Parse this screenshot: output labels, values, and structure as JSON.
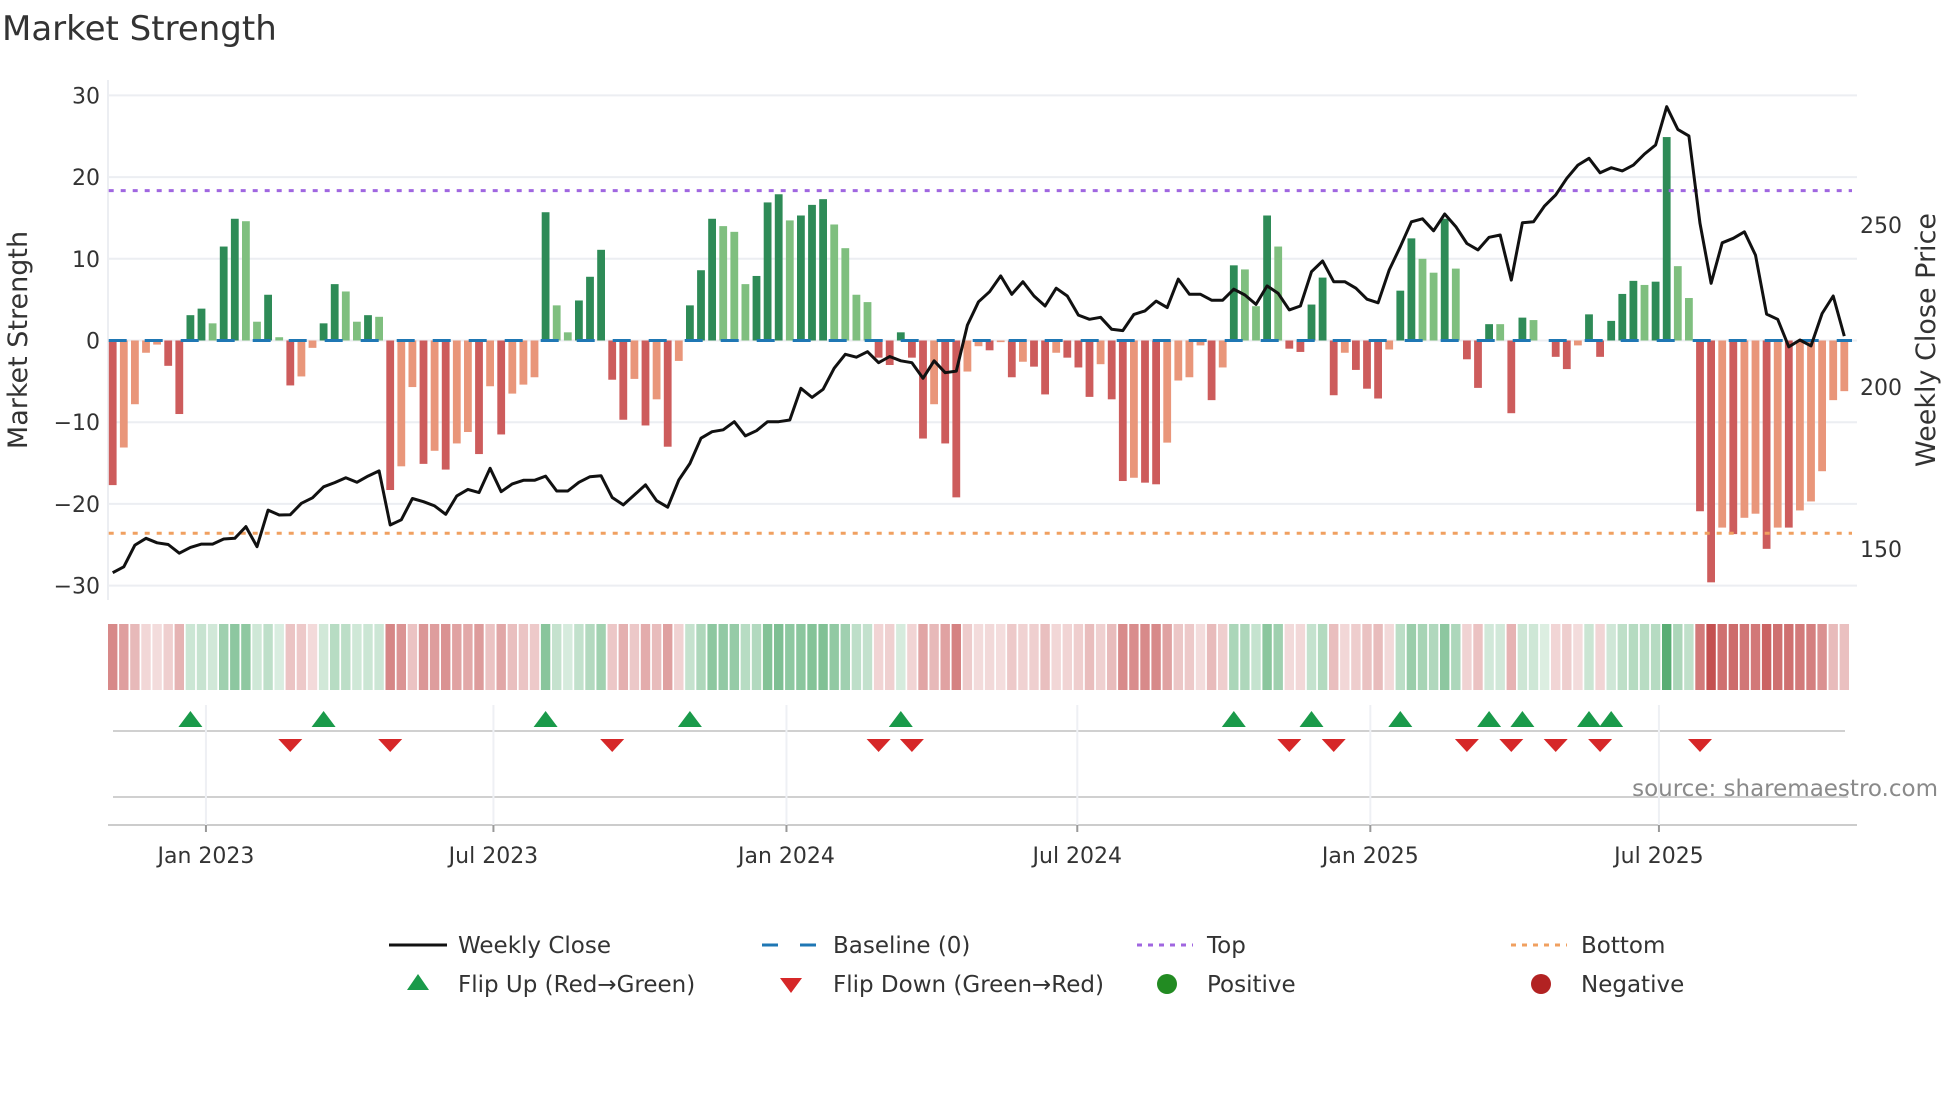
{
  "title": "Market Strength",
  "source": "source: sharemaestro.com",
  "colors": {
    "bar_pos_strong": "#2e8b57",
    "bar_pos_weak": "#7fbf7f",
    "bar_neg_strong": "#cd5c5c",
    "bar_neg_weak": "#e9967a",
    "price": "#111111",
    "baseline": "#1f77b4",
    "top": "#a066e0",
    "bottom": "#f0a060",
    "flip_up": "#1a9a4a",
    "flip_down": "#d62728",
    "positive": "#228b22",
    "negative": "#b22222",
    "strip_pos": "#3a9e5a",
    "strip_neg": "#c24a4a"
  },
  "chart_data": {
    "type": "bar",
    "title": "Market Strength",
    "ylabel": "Market Strength",
    "y2label": "Weekly Close Price",
    "ylim": [
      -31.5,
      31.5
    ],
    "y2lim": [
      133,
      297
    ],
    "yticks": [
      30,
      20,
      10,
      0,
      -10,
      -20,
      -30
    ],
    "ytick_labels": [
      "30",
      "20",
      "10",
      "0",
      "−10",
      "−20",
      "−30"
    ],
    "y2ticks": [
      250,
      200,
      150
    ],
    "y2tick_labels": [
      "250",
      "200",
      "150"
    ],
    "x_unit": "week index",
    "xticks": [
      {
        "pos": 8.4,
        "label": "Jan 2023"
      },
      {
        "pos": 34.3,
        "label": "Jul 2023"
      },
      {
        "pos": 60.7,
        "label": "Jan 2024"
      },
      {
        "pos": 86.9,
        "label": "Jul 2024"
      },
      {
        "pos": 113.3,
        "label": "Jan 2025"
      },
      {
        "pos": 139.3,
        "label": "Jul 2025"
      }
    ],
    "grid": true,
    "top_level": 18.35,
    "bottom_level": -23.6,
    "baseline": 0,
    "strength": [
      -17.7,
      -13.1,
      -7.8,
      -1.5,
      -0.5,
      -3.1,
      -9.0,
      3.1,
      3.9,
      2.1,
      11.5,
      14.9,
      14.6,
      2.3,
      5.6,
      0.4,
      -5.5,
      -4.4,
      -0.9,
      2.1,
      6.9,
      6.0,
      2.3,
      3.1,
      2.9,
      -18.3,
      -15.4,
      -5.7,
      -15.1,
      -13.5,
      -15.8,
      -12.6,
      -11.2,
      -13.9,
      -5.6,
      -11.5,
      -6.5,
      -5.4,
      -4.5,
      15.7,
      4.3,
      1.0,
      4.9,
      7.8,
      11.1,
      -4.8,
      -9.7,
      -4.7,
      -10.4,
      -7.2,
      -13.0,
      -2.5,
      4.3,
      8.6,
      14.9,
      14.0,
      13.3,
      6.9,
      7.9,
      16.9,
      17.9,
      14.7,
      15.3,
      16.6,
      17.3,
      14.2,
      11.3,
      5.6,
      4.7,
      -2.1,
      -3.0,
      1.0,
      -2.1,
      -12.0,
      -7.8,
      -12.6,
      -19.2,
      -3.8,
      -0.7,
      -1.2,
      -0.2,
      -4.5,
      -2.6,
      -3.2,
      -6.6,
      -1.5,
      -2.1,
      -3.3,
      -6.9,
      -2.9,
      -7.2,
      -17.2,
      -16.8,
      -17.4,
      -17.6,
      -12.5,
      -4.9,
      -4.5,
      -0.6,
      -7.3,
      -3.3,
      9.2,
      8.7,
      4.2,
      15.3,
      11.5,
      -1.0,
      -1.4,
      4.4,
      7.7,
      -6.7,
      -1.5,
      -3.6,
      -5.9,
      -7.1,
      -1.1,
      6.1,
      12.5,
      10.0,
      8.3,
      14.9,
      8.8,
      -2.3,
      -5.8,
      2.0,
      2.0,
      -8.9,
      2.8,
      2.5,
      0,
      -2.0,
      -3.5,
      -0.6,
      3.2,
      -2.0,
      2.4,
      5.7,
      7.3,
      6.8,
      7.2,
      24.9,
      9.1,
      5.2,
      -20.9,
      -29.6,
      -22.9,
      -23.7,
      -21.7,
      -21.2,
      -25.5,
      -22.9,
      -22.9,
      -20.8,
      -19.7,
      -16.0,
      -7.3,
      -6.2
    ],
    "shade": [
      "d",
      "l",
      "l",
      "l",
      "l",
      "d",
      "d",
      "d",
      "d",
      "l",
      "d",
      "d",
      "l",
      "l",
      "d",
      "l",
      "d",
      "l",
      "l",
      "d",
      "d",
      "l",
      "l",
      "d",
      "l",
      "d",
      "l",
      "l",
      "d",
      "l",
      "d",
      "l",
      "l",
      "d",
      "l",
      "d",
      "l",
      "l",
      "l",
      "d",
      "l",
      "l",
      "d",
      "d",
      "d",
      "d",
      "d",
      "l",
      "d",
      "l",
      "d",
      "l",
      "d",
      "d",
      "d",
      "l",
      "l",
      "l",
      "d",
      "d",
      "d",
      "l",
      "d",
      "d",
      "d",
      "l",
      "l",
      "l",
      "l",
      "d",
      "d",
      "d",
      "d",
      "d",
      "l",
      "d",
      "d",
      "l",
      "l",
      "d",
      "l",
      "d",
      "l",
      "d",
      "d",
      "l",
      "d",
      "d",
      "d",
      "l",
      "d",
      "d",
      "l",
      "d",
      "d",
      "l",
      "l",
      "l",
      "l",
      "d",
      "l",
      "d",
      "l",
      "l",
      "d",
      "l",
      "d",
      "d",
      "d",
      "d",
      "d",
      "l",
      "d",
      "d",
      "d",
      "l",
      "d",
      "d",
      "l",
      "l",
      "d",
      "l",
      "d",
      "d",
      "d",
      "l",
      "d",
      "d",
      "l",
      "l",
      "d",
      "d",
      "l",
      "d",
      "d",
      "d",
      "d",
      "d",
      "l",
      "d",
      "d",
      "l",
      "l",
      "d",
      "d",
      "l",
      "d",
      "l",
      "l",
      "d",
      "l",
      "d",
      "l",
      "l",
      "l",
      "l",
      "l"
    ],
    "weekly_close": [
      142.7,
      144.5,
      151.2,
      153.3,
      151.9,
      151.4,
      148.7,
      150.5,
      151.5,
      151.5,
      153.1,
      153.3,
      156.9,
      150.7,
      162,
      160.5,
      160.6,
      164.1,
      165.8,
      169.2,
      170.5,
      172,
      170.6,
      172.5,
      174.1,
      157.4,
      159,
      165.6,
      164.6,
      163.3,
      160.7,
      166.4,
      168.4,
      167.4,
      174.9,
      167.7,
      170.1,
      171.2,
      171.2,
      172.5,
      167.9,
      167.9,
      170.6,
      172.3,
      172.6,
      165.9,
      163.6,
      166.7,
      169.8,
      164.9,
      162.9,
      171.3,
      176.4,
      184.2,
      186.2,
      186.8,
      189.3,
      184.9,
      186.5,
      189.3,
      189.3,
      189.8,
      199.6,
      196.8,
      199.3,
      205.8,
      210.1,
      209.2,
      210.9,
      207.5,
      209.4,
      208.1,
      207.5,
      202.7,
      208.1,
      204.4,
      204.9,
      219.1,
      226.3,
      229.4,
      234.3,
      228.6,
      232.5,
      228.1,
      225,
      230.5,
      228.1,
      222.2,
      220.9,
      221.5,
      217.8,
      217.4,
      222.4,
      223.5,
      226.5,
      224.5,
      233.3,
      228.6,
      228.6,
      226.8,
      226.8,
      230.2,
      228.4,
      225.5,
      231.2,
      228.9,
      223.8,
      225,
      235.6,
      238.9,
      232.5,
      232.5,
      230.5,
      227.1,
      226,
      236.1,
      243.3,
      251,
      251.9,
      248.2,
      253.4,
      249.5,
      244.3,
      242.3,
      246.2,
      246.9,
      233,
      250.7,
      251,
      255.9,
      259.3,
      264.4,
      268.5,
      270.6,
      266.1,
      267.7,
      266.7,
      268.5,
      271.9,
      274.7,
      286.5,
      279.5,
      277.5,
      250.5,
      232,
      244.5,
      245.9,
      247.9,
      240.7,
      222.5,
      220.9,
      212.4,
      214.5,
      212.7,
      222.7,
      228.1,
      215.7
    ],
    "legend_position": "bottom",
    "legend": [
      {
        "key": "line",
        "label": "Weekly Close"
      },
      {
        "key": "baseline",
        "label": "Baseline (0)"
      },
      {
        "key": "top",
        "label": "Top"
      },
      {
        "key": "bottom",
        "label": "Bottom"
      },
      {
        "key": "up",
        "label": "Flip Up (Red→Green)"
      },
      {
        "key": "down",
        "label": "Flip Down (Green→Red)"
      },
      {
        "key": "pos",
        "label": "Positive"
      },
      {
        "key": "neg",
        "label": "Negative"
      }
    ]
  }
}
